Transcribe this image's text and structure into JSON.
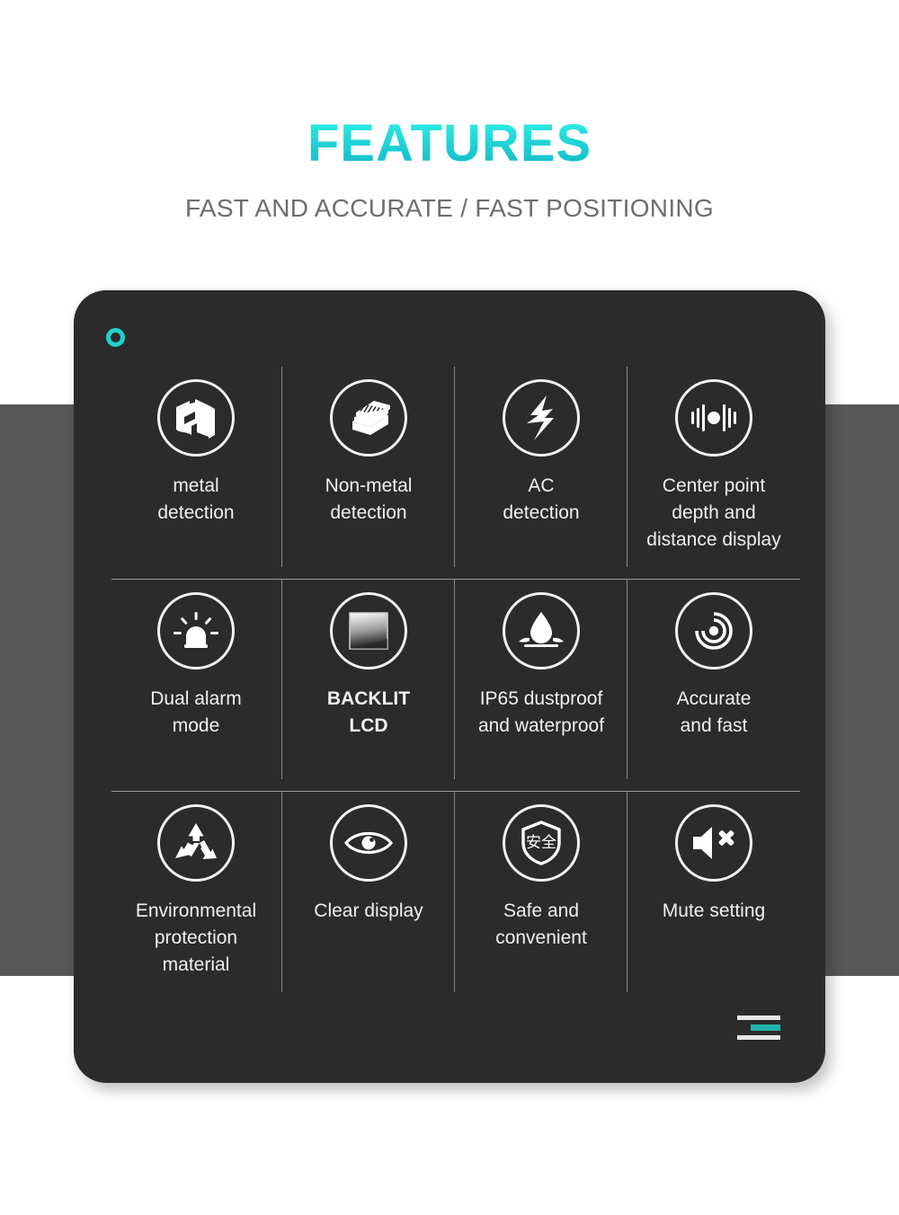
{
  "header": {
    "title": "FEATURES",
    "subtitle": "FAST AND ACCURATE / FAST POSITIONING"
  },
  "colors": {
    "accent": "#20d0cd",
    "accent_dark": "#20b3ae",
    "card_bg": "#2b2b2b",
    "band_gray": "#585858",
    "text_light": "#f0f0f0",
    "subtitle_gray": "#6e6e6e",
    "divider": "#8a8a8a"
  },
  "card": {
    "corner_ring_icon": "circle-ring-icon",
    "corner_bars_icon": "stacked-bars-icon"
  },
  "features": [
    {
      "icon": "i-beam-metal-icon",
      "label": "metal\ndetection",
      "bold": false
    },
    {
      "icon": "wood-layers-icon",
      "label": "Non-metal\ndetection",
      "bold": false
    },
    {
      "icon": "lightning-bolt-icon",
      "label": "AC\ndetection",
      "bold": false
    },
    {
      "icon": "center-point-bars-icon",
      "label": "Center point\ndepth and\ndistance display",
      "bold": false
    },
    {
      "icon": "alarm-beacon-icon",
      "label": "Dual alarm\nmode",
      "bold": false
    },
    {
      "icon": "backlit-screen-icon",
      "label": "BACKLIT\nLCD",
      "bold": true
    },
    {
      "icon": "water-droplet-icon",
      "label": "IP65 dustproof\nand waterproof",
      "bold": false
    },
    {
      "icon": "radar-target-icon",
      "label": "Accurate\nand fast",
      "bold": false
    },
    {
      "icon": "recycle-icon",
      "label": "Environmental\nprotection\nmaterial",
      "bold": false
    },
    {
      "icon": "eye-icon",
      "label": "Clear display",
      "bold": false
    },
    {
      "icon": "safety-shield-icon",
      "label": "Safe and\nconvenient",
      "bold": false
    },
    {
      "icon": "mute-speaker-icon",
      "label": "Mute setting",
      "bold": false
    }
  ],
  "shield_text": "安全"
}
